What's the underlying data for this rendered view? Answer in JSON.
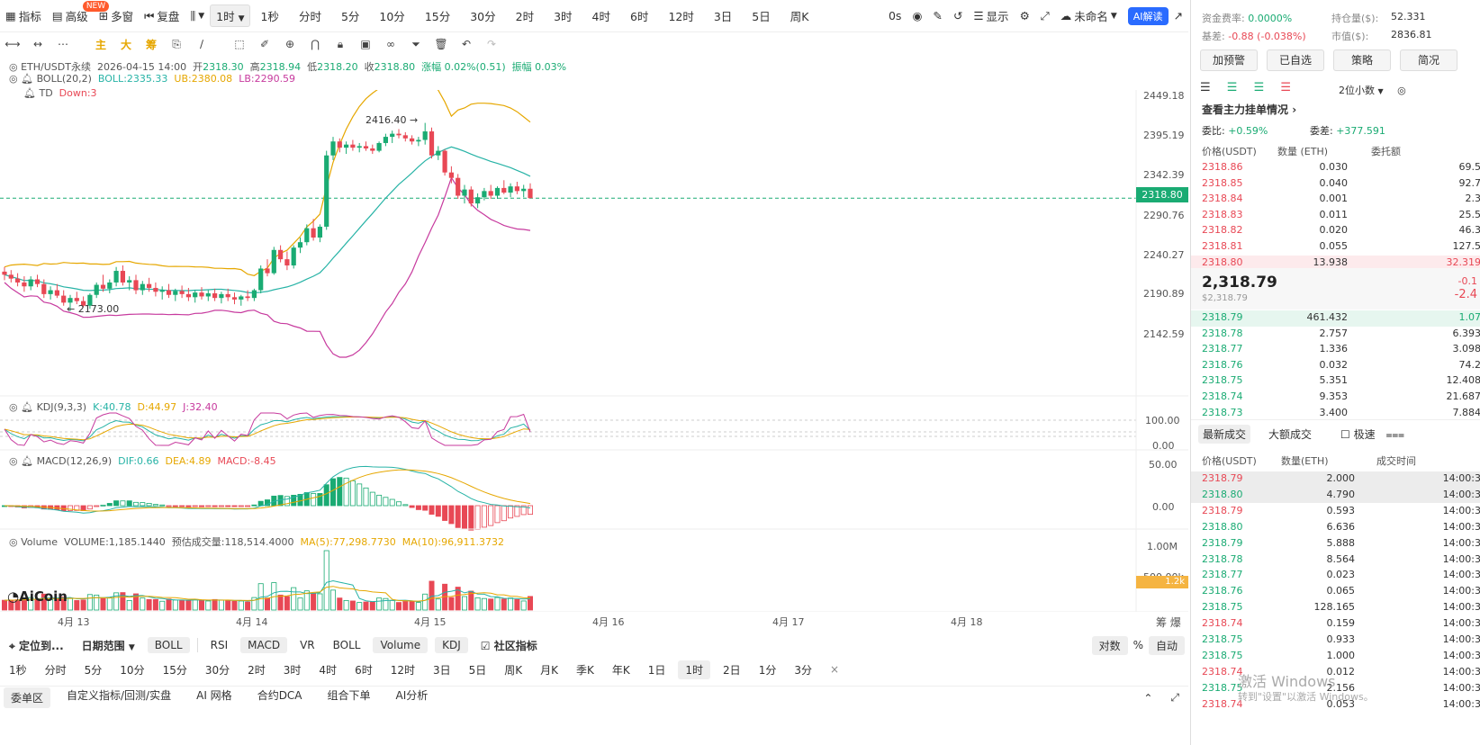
{
  "toolbar": {
    "items": [
      "指标",
      "高级",
      "多窗",
      "复盘"
    ],
    "new_badge": "NEW",
    "selected_timeframe": "1时",
    "timeframes": [
      "1秒",
      "分时",
      "5分",
      "10分",
      "15分",
      "30分",
      "2时",
      "3时",
      "4时",
      "6时",
      "12时",
      "3日",
      "5日",
      "周K"
    ],
    "countdown": "0s",
    "display": "显示",
    "account": "未命名",
    "ai_label": "AI解读"
  },
  "draw_tools": [
    "主",
    "大",
    "筹"
  ],
  "chart_info": {
    "symbol": "ETH/USDT永续",
    "time": "2026-04-15 14:00",
    "open_lbl": "开",
    "open": "2318.30",
    "high_lbl": "高",
    "high": "2318.94",
    "low_lbl": "低",
    "low": "2318.20",
    "close_lbl": "收",
    "close": "2318.80",
    "change": "涨幅 0.02%(0.51)",
    "amplitude": "振幅 0.03%",
    "boll_name": "BOLL(20,2)",
    "boll_mid": "BOLL:2335.33",
    "boll_ub": "UB:2380.08",
    "boll_lb": "LB:2290.59",
    "td_name": "TD",
    "td_val": "Down:3",
    "kdj_name": "KDJ(9,3,3)",
    "kdj_k": "K:40.78",
    "kdj_d": "D:44.97",
    "kdj_j": "J:32.40",
    "macd_name": "MACD(12,26,9)",
    "macd_dif": "DIF:0.66",
    "macd_dea": "DEA:4.89",
    "macd_val": "MACD:-8.45",
    "vol_name": "Volume",
    "vol_val": "VOLUME:1,185.1440",
    "vol_est": "预估成交量:118,514.4000",
    "vol_ma5": "MA(5):77,298.7730",
    "vol_ma10": "MA(10):96,911.3732",
    "price_high_marker": "2416.40 →",
    "price_low_marker": "← 2173.00",
    "logo": "AiCoin"
  },
  "chart_data": {
    "type": "candlestick",
    "y_axis_labels": [
      "2449.18",
      "2395.19",
      "2342.39",
      "2290.76",
      "2240.27",
      "2190.89",
      "2142.59"
    ],
    "current_price": "2318.80",
    "x_axis_labels": [
      "4月 13",
      "4月 14",
      "4月 15",
      "4月 16",
      "4月 17",
      "4月 18"
    ],
    "kdj_axis": [
      "100.00",
      "0.00"
    ],
    "macd_axis": [
      "50.00",
      "0.00"
    ],
    "vol_axis": [
      "1.00M",
      "500.00k"
    ],
    "vol_current": "1.2k",
    "candles": [
      [
        2224,
        2230,
        2213,
        2220
      ],
      [
        2220,
        2226,
        2210,
        2215
      ],
      [
        2215,
        2222,
        2205,
        2210
      ],
      [
        2210,
        2218,
        2198,
        2205
      ],
      [
        2205,
        2218,
        2200,
        2214
      ],
      [
        2214,
        2220,
        2204,
        2208
      ],
      [
        2208,
        2214,
        2190,
        2195
      ],
      [
        2195,
        2205,
        2188,
        2200
      ],
      [
        2200,
        2208,
        2190,
        2193
      ],
      [
        2193,
        2200,
        2180,
        2184
      ],
      [
        2184,
        2194,
        2173,
        2190
      ],
      [
        2190,
        2198,
        2182,
        2186
      ],
      [
        2186,
        2192,
        2178,
        2180
      ],
      [
        2180,
        2196,
        2176,
        2194
      ],
      [
        2194,
        2210,
        2190,
        2207
      ],
      [
        2207,
        2220,
        2198,
        2202
      ],
      [
        2202,
        2214,
        2196,
        2210
      ],
      [
        2210,
        2230,
        2205,
        2225
      ],
      [
        2225,
        2232,
        2206,
        2210
      ],
      [
        2210,
        2218,
        2200,
        2213
      ],
      [
        2213,
        2220,
        2195,
        2200
      ],
      [
        2200,
        2212,
        2194,
        2208
      ],
      [
        2208,
        2216,
        2198,
        2203
      ],
      [
        2203,
        2210,
        2192,
        2198
      ],
      [
        2198,
        2205,
        2188,
        2200
      ],
      [
        2200,
        2208,
        2190,
        2194
      ],
      [
        2194,
        2202,
        2186,
        2199
      ],
      [
        2199,
        2206,
        2190,
        2195
      ],
      [
        2195,
        2203,
        2186,
        2191
      ],
      [
        2191,
        2200,
        2184,
        2197
      ],
      [
        2197,
        2204,
        2188,
        2192
      ],
      [
        2192,
        2200,
        2186,
        2196
      ],
      [
        2196,
        2202,
        2186,
        2190
      ],
      [
        2190,
        2198,
        2183,
        2195
      ],
      [
        2195,
        2202,
        2186,
        2191
      ],
      [
        2191,
        2197,
        2182,
        2188
      ],
      [
        2188,
        2194,
        2180,
        2192
      ],
      [
        2192,
        2200,
        2186,
        2190
      ],
      [
        2190,
        2202,
        2186,
        2200
      ],
      [
        2200,
        2232,
        2196,
        2228
      ],
      [
        2228,
        2240,
        2218,
        2222
      ],
      [
        2222,
        2256,
        2220,
        2252
      ],
      [
        2252,
        2258,
        2236,
        2240
      ],
      [
        2240,
        2250,
        2226,
        2232
      ],
      [
        2232,
        2258,
        2228,
        2255
      ],
      [
        2255,
        2268,
        2248,
        2262
      ],
      [
        2262,
        2285,
        2258,
        2280
      ],
      [
        2280,
        2292,
        2264,
        2268
      ],
      [
        2268,
        2285,
        2262,
        2282
      ],
      [
        2282,
        2380,
        2278,
        2374
      ],
      [
        2374,
        2398,
        2368,
        2392
      ],
      [
        2392,
        2396,
        2378,
        2384
      ],
      [
        2384,
        2392,
        2376,
        2388
      ],
      [
        2388,
        2394,
        2380,
        2384
      ],
      [
        2384,
        2390,
        2378,
        2386
      ],
      [
        2386,
        2392,
        2380,
        2383
      ],
      [
        2383,
        2388,
        2376,
        2380
      ],
      [
        2380,
        2392,
        2378,
        2390
      ],
      [
        2390,
        2402,
        2386,
        2398
      ],
      [
        2398,
        2406,
        2390,
        2402
      ],
      [
        2402,
        2408,
        2396,
        2400
      ],
      [
        2400,
        2404,
        2392,
        2396
      ],
      [
        2396,
        2400,
        2388,
        2392
      ],
      [
        2392,
        2398,
        2386,
        2394
      ],
      [
        2394,
        2416,
        2388,
        2405
      ],
      [
        2405,
        2410,
        2370,
        2374
      ],
      [
        2374,
        2386,
        2368,
        2380
      ],
      [
        2380,
        2382,
        2348,
        2352
      ],
      [
        2352,
        2360,
        2338,
        2345
      ],
      [
        2345,
        2350,
        2318,
        2322
      ],
      [
        2322,
        2336,
        2312,
        2330
      ],
      [
        2330,
        2334,
        2308,
        2312
      ],
      [
        2312,
        2325,
        2306,
        2320
      ],
      [
        2320,
        2332,
        2316,
        2328
      ],
      [
        2328,
        2336,
        2318,
        2322
      ],
      [
        2322,
        2334,
        2318,
        2332
      ],
      [
        2332,
        2342,
        2324,
        2326
      ],
      [
        2326,
        2338,
        2320,
        2334
      ],
      [
        2334,
        2340,
        2324,
        2328
      ],
      [
        2328,
        2336,
        2320,
        2331
      ],
      [
        2331,
        2338,
        2322,
        2318.8
      ]
    ]
  },
  "bottom_bar1": {
    "locate": "定位到...",
    "date_range": "日期范围",
    "indicators": [
      "BOLL",
      "RSI",
      "MACD",
      "VR",
      "BOLL",
      "Volume",
      "KDJ"
    ],
    "community": "社区指标",
    "log": "对数",
    "pct": "%",
    "auto": "自动"
  },
  "bottom_bar2": {
    "timeframes": [
      "1秒",
      "分时",
      "5分",
      "10分",
      "15分",
      "30分",
      "2时",
      "3时",
      "4时",
      "6时",
      "12时",
      "3日",
      "5日",
      "周K",
      "月K",
      "季K",
      "年K",
      "1日",
      "1时",
      "2日",
      "1分",
      "3分"
    ],
    "close": "×"
  },
  "bottom_bar3": {
    "tabs": [
      "委单区",
      "自定义指标/回测/实盘",
      "AI 网格",
      "合约DCA",
      "组合下单",
      "AI分析"
    ]
  },
  "right_panel": {
    "top_rows": [
      {
        "label": "资金费率:",
        "value": "0.0000%",
        "label2": "持仓量($):",
        "value2": "52.331"
      },
      {
        "label": "基差:",
        "value": "-0.88 (-0.038%)",
        "label2": "市值($):",
        "value2": "2836.81"
      }
    ],
    "buttons": [
      "加预警",
      "已自选",
      "策略",
      "简况"
    ],
    "decimals": "2位小数",
    "main_orders": "查看主力挂单情况",
    "ratio_lbl": "委比:",
    "ratio_val": "+0.59%",
    "diff_lbl": "委差:",
    "diff_val": "+377.591",
    "ob_headers": [
      "价格(USDT)",
      "数量 (ETH)",
      "委托额"
    ],
    "asks": [
      [
        "2318.86",
        "0.030",
        "69.5"
      ],
      [
        "2318.85",
        "0.040",
        "92.7"
      ],
      [
        "2318.84",
        "0.001",
        "2.3"
      ],
      [
        "2318.83",
        "0.011",
        "25.5"
      ],
      [
        "2318.82",
        "0.020",
        "46.3"
      ],
      [
        "2318.81",
        "0.055",
        "127.5"
      ],
      [
        "2318.80",
        "13.938",
        "32.319"
      ]
    ],
    "mid_price": "2,318.79",
    "mid_sub": "$2,318.79",
    "mid_change1": "-0.1",
    "mid_change2": "-2.4",
    "bids": [
      [
        "2318.79",
        "461.432",
        "1.07"
      ],
      [
        "2318.78",
        "2.757",
        "6.393"
      ],
      [
        "2318.77",
        "1.336",
        "3.098"
      ],
      [
        "2318.76",
        "0.032",
        "74.2"
      ],
      [
        "2318.75",
        "5.351",
        "12.408"
      ],
      [
        "2318.74",
        "9.353",
        "21.687"
      ],
      [
        "2318.73",
        "3.400",
        "7.884"
      ]
    ],
    "trade_tabs": [
      "最新成交",
      "大额成交"
    ],
    "fast": "极速",
    "trade_headers": [
      "价格(USDT)",
      "数量(ETH)",
      "成交时间"
    ],
    "trades": [
      [
        "2318.79",
        "2.000",
        "14:00:3",
        "r"
      ],
      [
        "2318.80",
        "4.790",
        "14:00:3",
        "g"
      ],
      [
        "2318.79",
        "0.593",
        "14:00:3",
        "r"
      ],
      [
        "2318.80",
        "6.636",
        "14:00:3",
        "g"
      ],
      [
        "2318.79",
        "5.888",
        "14:00:3",
        "g"
      ],
      [
        "2318.78",
        "8.564",
        "14:00:3",
        "g"
      ],
      [
        "2318.77",
        "0.023",
        "14:00:3",
        "g"
      ],
      [
        "2318.76",
        "0.065",
        "14:00:3",
        "g"
      ],
      [
        "2318.75",
        "128.165",
        "14:00:3",
        "g"
      ],
      [
        "2318.74",
        "0.159",
        "14:00:3",
        "r"
      ],
      [
        "2318.75",
        "0.933",
        "14:00:3",
        "g"
      ],
      [
        "2318.75",
        "1.000",
        "14:00:3",
        "g"
      ],
      [
        "2318.74",
        "0.012",
        "14:00:3",
        "r"
      ],
      [
        "2318.75",
        "2.156",
        "14:00:3",
        "g"
      ],
      [
        "2318.74",
        "0.053",
        "14:00:3",
        "r"
      ]
    ],
    "watermark1": "激活 Windows",
    "watermark2": "转到\"设置\"以激活 Windows。"
  },
  "colors": {
    "up": "#1aab73",
    "down": "#e84855",
    "boll_ub": "#e6a700",
    "boll_mid": "#27b3a6",
    "boll_lb": "#c73a9e",
    "accent": "#2a6bff"
  }
}
